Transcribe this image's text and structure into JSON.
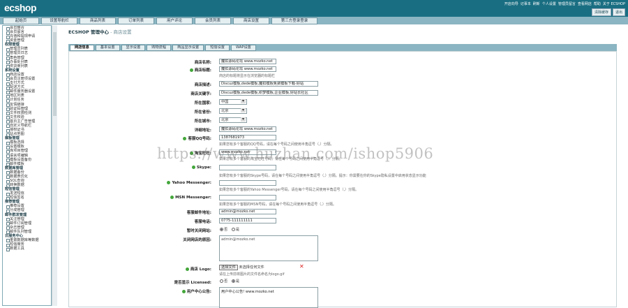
{
  "header": {
    "logo": "ecshop",
    "links": [
      "开店向导",
      "记事本",
      "刷新",
      "个人设置",
      "管理员留言",
      "查看网店",
      "帮助",
      "关于 ECSHOP"
    ],
    "buttons": [
      "清除缓存",
      "退出"
    ]
  },
  "nav": {
    "tabs": [
      "起始页",
      "设置导航栏",
      "商品列表",
      "订单列表",
      "用户评论",
      "会员列表",
      "商店设置",
      "第三方登录登录"
    ]
  },
  "sidebar": [
    {
      "type": "item",
      "label": "会员整合"
    },
    {
      "type": "item",
      "label": "会员留言"
    },
    {
      "type": "item",
      "label": "充值和提现申请"
    },
    {
      "type": "item",
      "label": "资金管理"
    },
    {
      "type": "group",
      "label": "权限管理"
    },
    {
      "type": "item",
      "label": "管理员列表"
    },
    {
      "type": "item",
      "label": "管理员日志"
    },
    {
      "type": "item",
      "label": "角色管理"
    },
    {
      "type": "item",
      "label": "办事处列表"
    },
    {
      "type": "item",
      "label": "供货商列表"
    },
    {
      "type": "group",
      "label": "系统设置"
    },
    {
      "type": "item",
      "label": "商店设置"
    },
    {
      "type": "item",
      "label": "会员注册项设置"
    },
    {
      "type": "item",
      "label": "支付方式"
    },
    {
      "type": "item",
      "label": "配送方式"
    },
    {
      "type": "item",
      "label": "邮件服务器设置"
    },
    {
      "type": "item",
      "label": "地区列表"
    },
    {
      "type": "item",
      "label": "计划任务"
    },
    {
      "type": "item",
      "label": "友情链接"
    },
    {
      "type": "item",
      "label": "验证码管理"
    },
    {
      "type": "item",
      "label": "文件权限检测"
    },
    {
      "type": "item",
      "label": "文件校验"
    },
    {
      "type": "item",
      "label": "首页主广告管理"
    },
    {
      "type": "item",
      "label": "自定义导航栏"
    },
    {
      "type": "item",
      "label": "授权证书"
    },
    {
      "type": "item",
      "label": "站点地图"
    },
    {
      "type": "group",
      "label": "模板管理"
    },
    {
      "type": "item",
      "label": "模板选择"
    },
    {
      "type": "item",
      "label": "设置模板"
    },
    {
      "type": "item",
      "label": "库项目管理"
    },
    {
      "type": "item",
      "label": "语言项编辑"
    },
    {
      "type": "item",
      "label": "模板设置备份"
    },
    {
      "type": "item",
      "label": "邮件模板"
    },
    {
      "type": "group",
      "label": "数据库管理"
    },
    {
      "type": "item",
      "label": "数据备份"
    },
    {
      "type": "item",
      "label": "数据表优化"
    },
    {
      "type": "item",
      "label": "SQL查询"
    },
    {
      "type": "item",
      "label": "转换数据"
    },
    {
      "type": "group",
      "label": "短信管理"
    },
    {
      "type": "item",
      "label": "发送短信"
    },
    {
      "type": "item",
      "label": "短信签名"
    },
    {
      "type": "group",
      "label": "推荐管理"
    },
    {
      "type": "item",
      "label": "推荐设置"
    },
    {
      "type": "item",
      "label": "分成管理"
    },
    {
      "type": "group",
      "label": "邮件群发管理"
    },
    {
      "type": "item",
      "label": "关注管理"
    },
    {
      "type": "item",
      "label": "邮件订阅管理"
    },
    {
      "type": "item",
      "label": "杂志管理"
    },
    {
      "type": "item",
      "label": "邮件队列管理"
    },
    {
      "type": "group",
      "label": "云服务中心"
    },
    {
      "type": "item",
      "label": "重置数据库等数据"
    },
    {
      "type": "item",
      "label": "短信服务"
    },
    {
      "type": "item",
      "label": "数据工具"
    }
  ],
  "main": {
    "breadcrumb_root": "ECSHOP 管理中心",
    "breadcrumb_page": " - 商店设置",
    "tabs": [
      "网店信息",
      "基本设置",
      "显示设置",
      "购物流程",
      "商品显示设置",
      "短信设置",
      "WAP设置"
    ],
    "watermark": "https://www.huzhan.com/ishop5906",
    "fields": {
      "shop_name": {
        "label": "商店名称:",
        "value": "魔扣源码论坛 www.mozko.net"
      },
      "shop_title": {
        "label": "商店标题:",
        "value": "魔扣源码论坛 www.mozko.net",
        "hint": "商店的标题将显示在浏览器的标题栏"
      },
      "shop_desc": {
        "label": "商店描述:",
        "value": "Discuz模板,dede模板,魔扣模板免费模板下载-好站"
      },
      "shop_keywords": {
        "label": "商店关键字:",
        "value": "Discuz模板,dede模板,织梦模板,企业模板,好站长社区"
      },
      "country": {
        "label": "所在国家:",
        "value": "中国"
      },
      "province": {
        "label": "所在省份:",
        "value": "北京"
      },
      "city": {
        "label": "所在城市:",
        "value": "北京"
      },
      "address": {
        "label": "详细地址:",
        "value": "魔扣源码论坛 www.mozko.net"
      },
      "qq": {
        "label": "客服QQ号码:",
        "value": "1387681973",
        "hint": "如果您有多个客服的QQ号码，请在每个号码之间使用半角逗号（,）分隔。"
      },
      "taobao": {
        "label": "淘宝旺旺:",
        "value": "www.mozko.net",
        "hint": "如果您有多个客服的淘宝旺旺号码，请在每个号码之间使用半角逗号（,）分隔。"
      },
      "skype": {
        "label": "Skype:",
        "value": "",
        "hint": "如果您有多个客服的Skype号码，请在每个号码之间使用半角逗号（,）分隔。提示：你需要在你的Skype隐私设置中启用状态显示功能"
      },
      "yahoo": {
        "label": "Yahoo Messenger:",
        "value": "",
        "hint": "如果您有多个客服的Yahoo Messenger号码，请在每个号码之间使用半角逗号（,）分隔。"
      },
      "msn": {
        "label": "MSN Messenger:",
        "value": "",
        "hint": "如果您有多个客服的MSN号码，请在每个号码之间使用半角逗号（,）分隔。"
      },
      "email": {
        "label": "客服邮件地址:",
        "value": "admin@mozko.net"
      },
      "phone": {
        "label": "客服电话:",
        "value": "0775-111111111"
      },
      "closed": {
        "label": "暂时关闭网站:",
        "options": [
          "否",
          "是"
        ],
        "selected": "否"
      },
      "close_reason": {
        "label": "关闭网店的原因:",
        "value": "admin@mozko.net"
      },
      "logo": {
        "label": "商店 Logo:",
        "button": "选择文件",
        "file": "未选择任何文件",
        "hint": "请在上传前将图片的文件名命名为logo.gif"
      },
      "licensed": {
        "label": "是否显示 Licensed:",
        "options": [
          "否",
          "是"
        ],
        "selected": "是"
      },
      "notice": {
        "label": "用户中心公告:",
        "value": "用户中心公告! www.mozko.net"
      }
    }
  }
}
